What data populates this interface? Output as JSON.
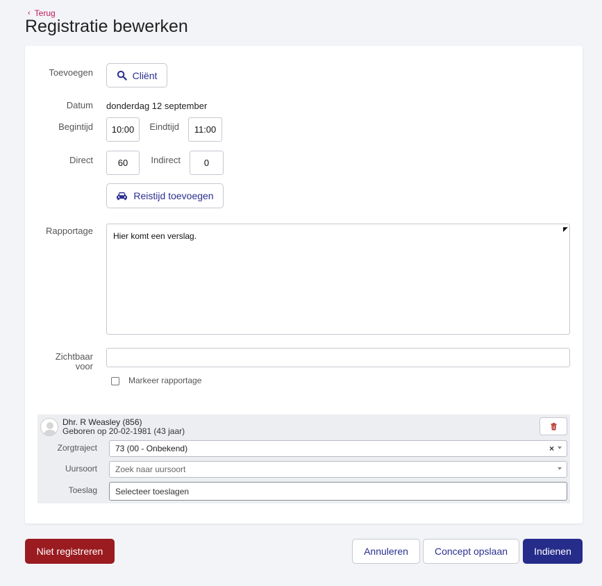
{
  "nav": {
    "back_label": "Terug"
  },
  "page": {
    "title": "Registratie bewerken"
  },
  "form": {
    "toevoegen_label": "Toevoegen",
    "client_button_label": "Cliënt",
    "datum_label": "Datum",
    "datum_value": "donderdag 12 september",
    "begintijd_label": "Begintijd",
    "begintijd_value": "10:00",
    "eindtijd_label": "Eindtijd",
    "eindtijd_value": "11:00",
    "direct_label": "Direct",
    "direct_value": "60",
    "indirect_label": "Indirect",
    "indirect_value": "0",
    "reistijd_button_label": "Reistijd toevoegen",
    "rapportage_label": "Rapportage",
    "rapportage_value": "Hier komt een verslag.",
    "zichtbaar_label_line1": "Zichtbaar",
    "zichtbaar_label_line2": "voor",
    "zichtbaar_value": "",
    "markeer_label": "Markeer rapportage",
    "markeer_checked": false
  },
  "client": {
    "name": "Dhr. R Weasley (856)",
    "dob": "Geboren op 20-02-1981 (43 jaar)",
    "zorgtraject_label": "Zorgtraject",
    "zorgtraject_value": "73 (00 - Onbekend)",
    "uursoort_label": "Uursoort",
    "uursoort_placeholder": "Zoek naar uursoort",
    "toeslag_label": "Toeslag",
    "toeslag_placeholder": "Selecteer toeslagen"
  },
  "actions": {
    "niet_registreren": "Niet registreren",
    "annuleren": "Annuleren",
    "concept_opslaan": "Concept opslaan",
    "indienen": "Indienen"
  },
  "colors": {
    "accent": "#262c8a",
    "danger": "#9a1b20",
    "link": "#c2185b",
    "background": "#f3f4f8"
  }
}
